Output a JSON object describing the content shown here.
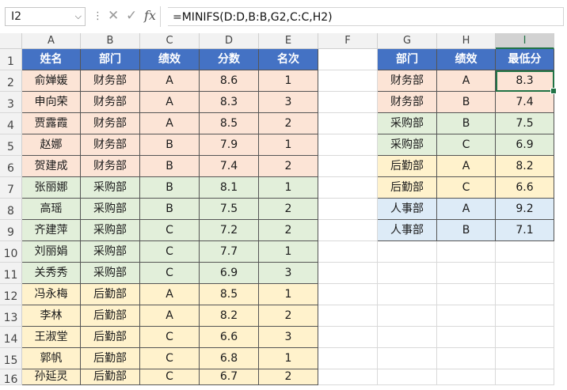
{
  "formula_bar": {
    "name_box": "I2",
    "formula": "=MINIFS(D:D,B:B,G2,C:C,H2)",
    "icons": [
      "cancel-icon",
      "confirm-icon",
      "fx-icon"
    ]
  },
  "columns": [
    "A",
    "B",
    "C",
    "D",
    "E",
    "F",
    "G",
    "H",
    "I"
  ],
  "selected_column": "I",
  "rows": [
    "1",
    "2",
    "3",
    "4",
    "5",
    "6",
    "7",
    "8",
    "9",
    "10",
    "11",
    "12",
    "13",
    "14",
    "15",
    "16"
  ],
  "main_table": {
    "headers": [
      "姓名",
      "部门",
      "绩效",
      "分数",
      "名次"
    ],
    "rows": [
      [
        "俞婵媛",
        "财务部",
        "A",
        "8.6",
        "1"
      ],
      [
        "申向荣",
        "财务部",
        "A",
        "8.3",
        "3"
      ],
      [
        "贾露霞",
        "财务部",
        "A",
        "8.5",
        "2"
      ],
      [
        "赵娜",
        "财务部",
        "B",
        "7.9",
        "1"
      ],
      [
        "贺建成",
        "财务部",
        "B",
        "7.4",
        "2"
      ],
      [
        "张丽娜",
        "采购部",
        "B",
        "8.1",
        "1"
      ],
      [
        "高瑶",
        "采购部",
        "B",
        "7.5",
        "2"
      ],
      [
        "齐建萍",
        "采购部",
        "C",
        "7.2",
        "2"
      ],
      [
        "刘丽娟",
        "采购部",
        "C",
        "7.7",
        "1"
      ],
      [
        "关秀秀",
        "采购部",
        "C",
        "6.9",
        "3"
      ],
      [
        "冯永梅",
        "后勤部",
        "A",
        "8.5",
        "1"
      ],
      [
        "李林",
        "后勤部",
        "A",
        "8.2",
        "2"
      ],
      [
        "王淑堂",
        "后勤部",
        "C",
        "6.6",
        "3"
      ],
      [
        "郭帆",
        "后勤部",
        "C",
        "6.8",
        "1"
      ],
      [
        "孙延灵",
        "后勤部",
        "C",
        "6.7",
        "2"
      ]
    ]
  },
  "summary_table": {
    "headers": [
      "部门",
      "绩效",
      "最低分"
    ],
    "rows": [
      [
        "财务部",
        "A",
        "8.3"
      ],
      [
        "财务部",
        "B",
        "7.4"
      ],
      [
        "采购部",
        "B",
        "7.5"
      ],
      [
        "采购部",
        "C",
        "6.9"
      ],
      [
        "后勤部",
        "A",
        "8.2"
      ],
      [
        "后勤部",
        "C",
        "6.6"
      ],
      [
        "人事部",
        "A",
        "9.2"
      ],
      [
        "人事部",
        "B",
        "7.1"
      ]
    ]
  },
  "department_colors": {
    "财务部": "#fce4d6",
    "采购部": "#e2efda",
    "后勤部": "#fff2cc",
    "人事部": "#ddebf7"
  },
  "header_color": "#4472c4",
  "active_cell": "I2"
}
